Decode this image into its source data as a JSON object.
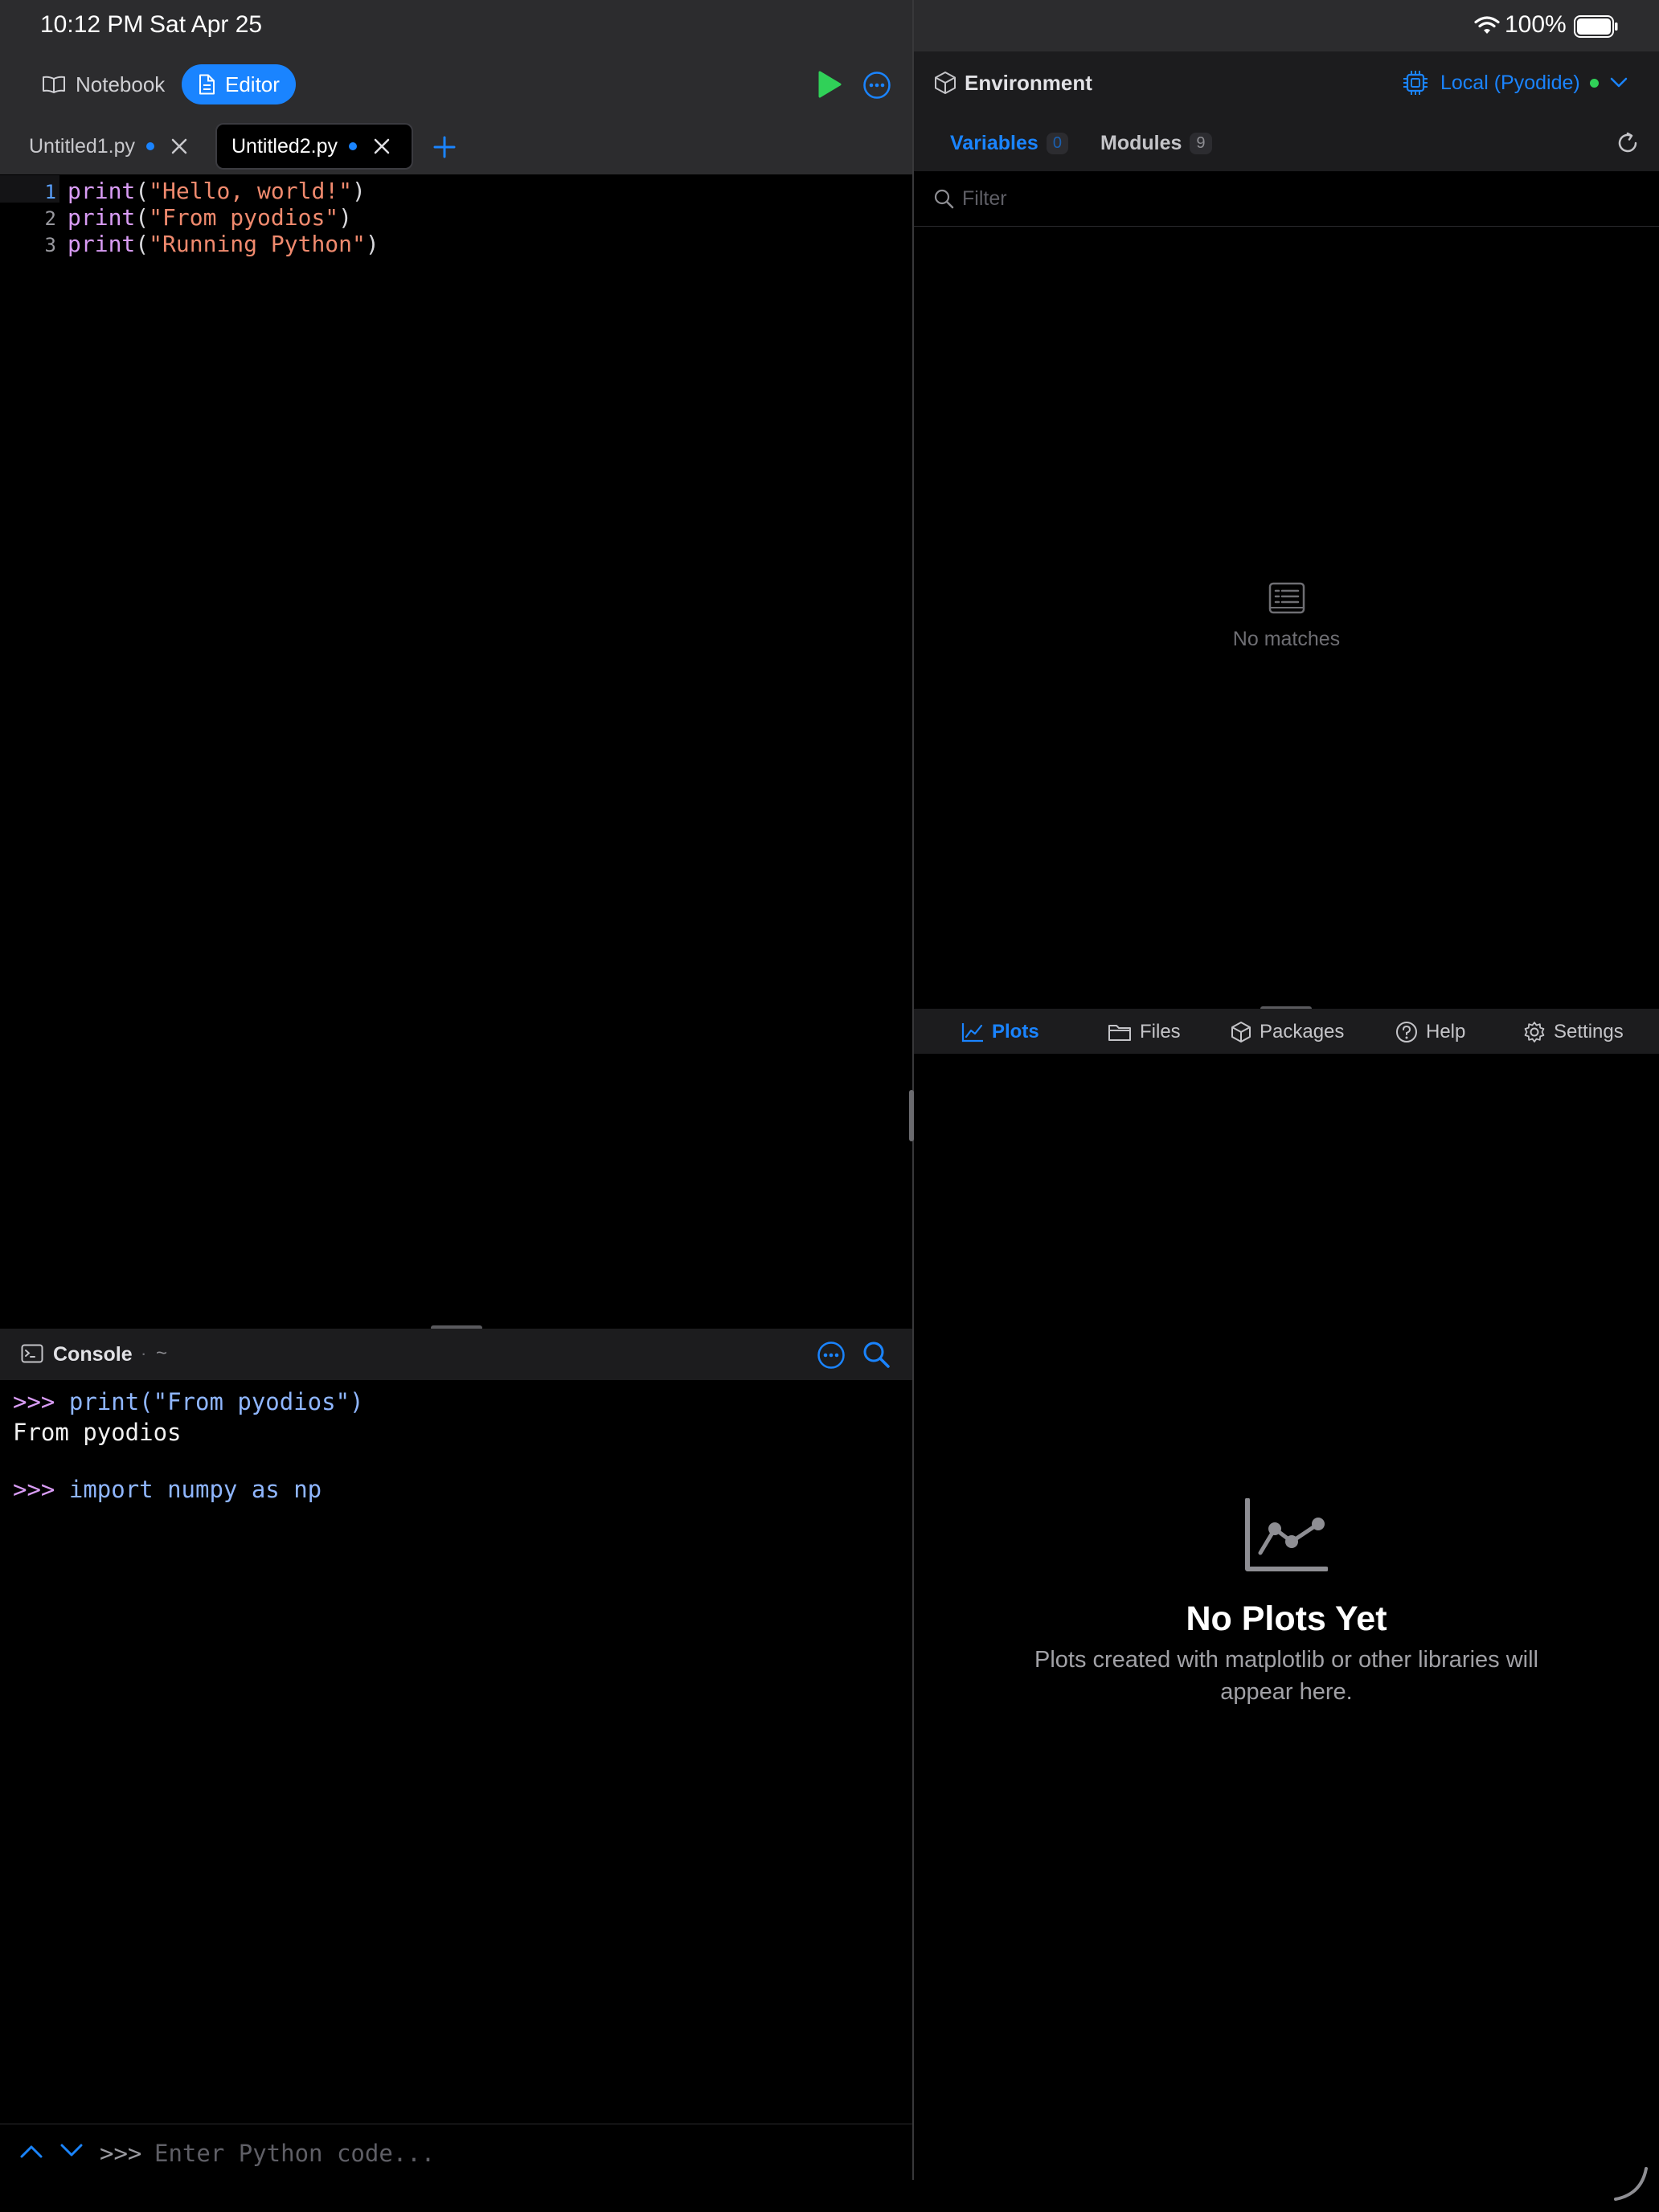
{
  "status_bar": {
    "time": "10:12 PM",
    "date": "Sat Apr 25",
    "battery": "100%"
  },
  "left": {
    "mode_buttons": {
      "notebook": "Notebook",
      "editor": "Editor"
    },
    "tabs": [
      {
        "label": "Untitled1.py",
        "modified": true,
        "active": false
      },
      {
        "label": "Untitled2.py",
        "modified": true,
        "active": true
      }
    ],
    "editor": {
      "lines": [
        {
          "num": "1",
          "fn": "print",
          "arg": "\"Hello, world!\""
        },
        {
          "num": "2",
          "fn": "print",
          "arg": "\"From pyodios\""
        },
        {
          "num": "3",
          "fn": "print",
          "arg": "\"Running Python\""
        }
      ]
    },
    "console": {
      "title": "Console",
      "path": "~",
      "separator": "·",
      "lines": [
        {
          "prompt": ">>>",
          "input": "print(\"From pyodios\")"
        },
        {
          "output": "From pyodios"
        },
        {
          "prompt": ">>>",
          "input": "import numpy as np"
        }
      ],
      "input_prompt": ">>>",
      "input_placeholder": "Enter Python code..."
    }
  },
  "right": {
    "environment_title": "Environment",
    "kernel": "Local (Pyodide)",
    "env_tabs": [
      {
        "label": "Variables",
        "count": "0",
        "active": true
      },
      {
        "label": "Modules",
        "count": "9",
        "active": false
      }
    ],
    "filter_placeholder": "Filter",
    "variables_empty": "No matches",
    "bottom_tabs": [
      {
        "label": "Plots",
        "icon": "chart-icon",
        "active": true
      },
      {
        "label": "Files",
        "icon": "folder-icon",
        "active": false
      },
      {
        "label": "Packages",
        "icon": "cube-icon",
        "active": false
      },
      {
        "label": "Help",
        "icon": "question-icon",
        "active": false
      },
      {
        "label": "Settings",
        "icon": "gear-icon",
        "active": false
      }
    ],
    "plots_empty": {
      "title": "No Plots Yet",
      "subtitle_line1": "Plots created with matplotlib or other libraries will",
      "subtitle_line2": "appear here."
    }
  },
  "colors": {
    "accent": "#1a84ff",
    "run": "#30d158",
    "status_ok": "#30d158",
    "keyword": "#d99cf5",
    "string": "#f08a6e"
  }
}
